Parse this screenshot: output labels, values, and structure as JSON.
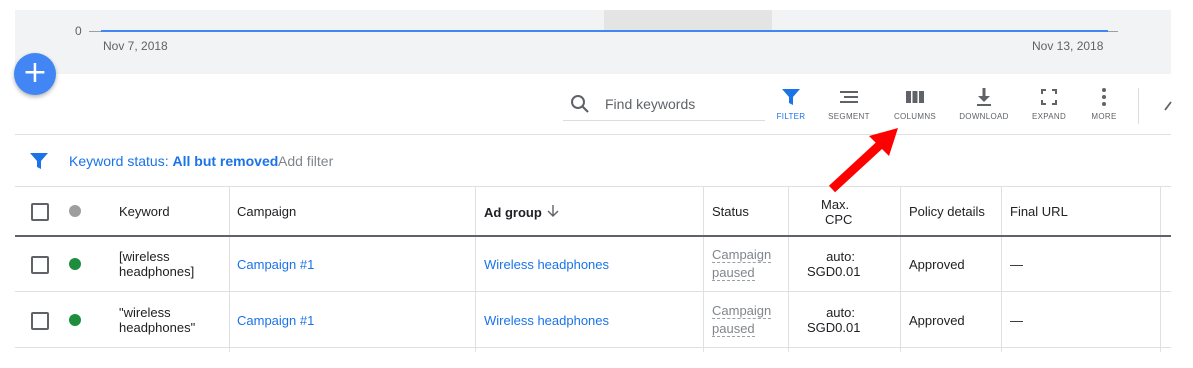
{
  "chart": {
    "y_zero_label": "0",
    "x_start_label": "Nov 7, 2018",
    "x_end_label": "Nov 13, 2018",
    "line_color": "#4285f4"
  },
  "fab": {
    "label": "+",
    "color": "#4285f4"
  },
  "search": {
    "placeholder": "Find keywords",
    "value": "",
    "icon": "search-icon"
  },
  "toolbar": {
    "filter": "FILTER",
    "segment": "SEGMENT",
    "columns": "COLUMNS",
    "download": "DOWNLOAD",
    "expand": "EXPAND",
    "more": "MORE",
    "active_color": "#1a73e8"
  },
  "filter_bar": {
    "label": "Keyword status: ",
    "value": "All but removed",
    "add_filter": "Add filter"
  },
  "table": {
    "headers": {
      "keyword": "Keyword",
      "campaign": "Campaign",
      "ad_group": "Ad group",
      "status": "Status",
      "max_cpc_line1": "Max.",
      "max_cpc_line2": "CPC",
      "policy": "Policy details",
      "final_url": "Final URL"
    },
    "sort": {
      "column": "Ad group",
      "direction": "descending"
    },
    "rows": [
      {
        "keyword_line1": "[wireless",
        "keyword_line2": "headphones]",
        "campaign": "Campaign #1",
        "ad_group": "Wireless headphones",
        "status_line1": "Campaign",
        "status_line2": "paused",
        "cpc_line1": "auto:",
        "cpc_line2": "SGD0.01",
        "policy": "Approved",
        "final_url": "—",
        "status_dot_color": "#1e8e3e"
      },
      {
        "keyword_line1": "\"wireless",
        "keyword_line2": "headphones\"",
        "campaign": "Campaign #1",
        "ad_group": "Wireless headphones",
        "status_line1": "Campaign",
        "status_line2": "paused",
        "cpc_line1": "auto:",
        "cpc_line2": "SGD0.01",
        "policy": "Approved",
        "final_url": "—",
        "status_dot_color": "#1e8e3e"
      }
    ]
  },
  "annotation": {
    "arrow_color": "#ff0000",
    "target": "COLUMNS"
  }
}
